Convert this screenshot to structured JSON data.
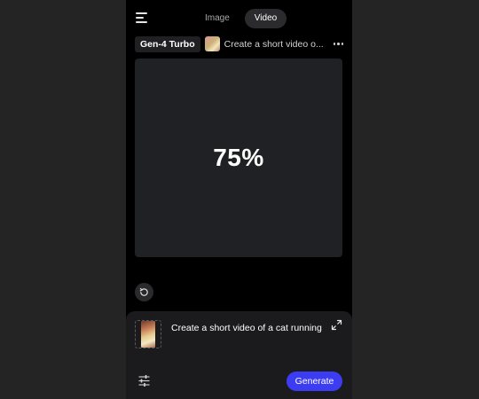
{
  "header": {
    "menu_icon": "hamburger-menu-icon",
    "tabs": [
      {
        "label": "Image",
        "active": false
      },
      {
        "label": "Video",
        "active": true
      }
    ]
  },
  "generation": {
    "model": "Gen-4 Turbo",
    "title": "Create a short video o...",
    "more_icon": "more-horizontal-icon"
  },
  "preview": {
    "progress_label": "75%",
    "progress": 0.75
  },
  "retry_icon": "refresh-icon",
  "composer": {
    "prompt": "Create a short video of a cat running",
    "expand_icon": "expand-icon",
    "settings_icon": "sliders-icon",
    "generate_label": "Generate"
  },
  "colors": {
    "page_background": "#242424",
    "app_background": "#000000",
    "panel": "#202124",
    "accent": "#3c3cf2"
  }
}
